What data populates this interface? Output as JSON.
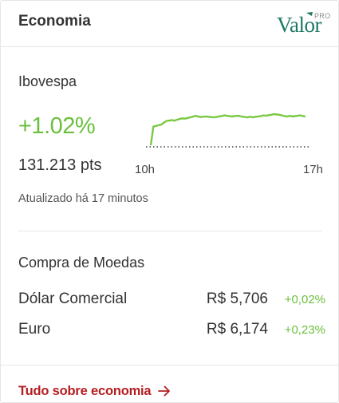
{
  "header": {
    "title": "Economia",
    "logo": {
      "wordmark": "Valor",
      "badge": "PRO",
      "icon": "valor-pro-logo"
    }
  },
  "ibovespa": {
    "title": "Ibovespa",
    "change": "+1.02%",
    "points": "131.213 pts",
    "updated": "Atualizado há 17 minutos",
    "change_color": "#6abf3b"
  },
  "chart_data": {
    "type": "line",
    "title": "",
    "xlabel": "",
    "ylabel": "",
    "x_tick_labels": [
      "10h",
      "17h"
    ],
    "grid": false,
    "baseline": "dotted",
    "series": [
      {
        "values": [
          0.05,
          0.62,
          0.64,
          0.66,
          0.68,
          0.74,
          0.79,
          0.8,
          0.82,
          0.8,
          0.83,
          0.85,
          0.87,
          0.86,
          0.88,
          0.9,
          0.92,
          0.95,
          0.93,
          0.91,
          0.92,
          0.93,
          0.92,
          0.91,
          0.9,
          0.91,
          0.93,
          0.94,
          0.96,
          0.95,
          0.94,
          0.93,
          0.94,
          0.95,
          0.94,
          0.92,
          0.91,
          0.9,
          0.92,
          0.9,
          0.92,
          0.93,
          0.94,
          0.96,
          0.95,
          0.97,
          0.98,
          1.0,
          0.99,
          0.98,
          0.96,
          0.94,
          0.93,
          0.95,
          0.93,
          0.94,
          0.95,
          0.96,
          0.94,
          0.93
        ],
        "color": "#7ac943"
      }
    ],
    "ylim": [
      0,
      1
    ]
  },
  "moedas": {
    "title": "Compra de Moedas",
    "rows": [
      {
        "name": "Dólar Comercial",
        "value": "R$ 5,706",
        "pct": "+0,02%"
      },
      {
        "name": "Euro",
        "value": "R$ 6,174",
        "pct": "+0,23%"
      }
    ]
  },
  "footer": {
    "link_label": "Tudo sobre economia",
    "link_icon": "arrow-right-icon",
    "link_color": "#b31e22"
  }
}
